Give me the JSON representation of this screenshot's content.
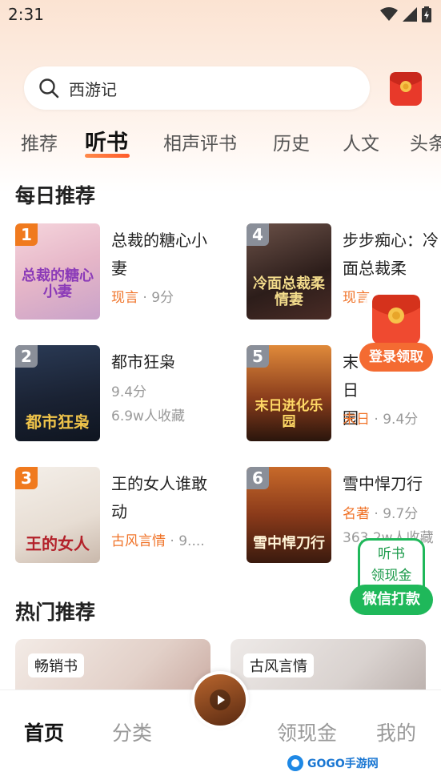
{
  "status_bar": {
    "time": "2:31"
  },
  "search": {
    "query": "西游记"
  },
  "tabs": [
    {
      "label": "推荐"
    },
    {
      "label": "听书"
    },
    {
      "label": "相声评书"
    },
    {
      "label": "历史"
    },
    {
      "label": "人文"
    },
    {
      "label": "头条"
    }
  ],
  "daily": {
    "title": "每日推荐",
    "books": [
      {
        "rank": "1",
        "title": "总裁的糖心小妻",
        "cover_text": "总裁的糖心小妻",
        "category": "现言",
        "meta": "9分"
      },
      {
        "rank": "4",
        "title": "步步痴心：冷面总裁柔",
        "cover_text": "冷面总裁柔情妻",
        "category": "现言",
        "meta": ""
      },
      {
        "rank": "2",
        "title": "都市狂枭",
        "cover_text": "都市狂枭",
        "meta_line1": "9.4分",
        "meta_line2": "6.9w人收藏"
      },
      {
        "rank": "5",
        "title": "末日园",
        "cover_text": "末日进化乐园",
        "category": "末日",
        "meta": "9.4分"
      },
      {
        "rank": "3",
        "title": "王的女人谁敢动",
        "cover_text": "王的女人",
        "category": "古风言情",
        "meta": "9...."
      },
      {
        "rank": "6",
        "title": "雪中悍刀行",
        "cover_text": "雪中悍刀行",
        "category": "名著",
        "meta": "9.7分",
        "meta_line2": "363.2w人收藏"
      }
    ]
  },
  "hot": {
    "title": "热门推荐",
    "cards": [
      {
        "tag": "畅销书"
      },
      {
        "tag": "古风言情"
      }
    ]
  },
  "floats": {
    "login_reward": "登录领取",
    "listen_line1": "听书",
    "listen_line2": "领现金",
    "wechat_pay": "微信打款"
  },
  "bottom_nav": {
    "home": "首页",
    "category": "分类",
    "cash": "领现金",
    "mine": "我的"
  },
  "watermark": "GOGO手游网",
  "colors": {
    "accent": "#f0742a",
    "green": "#1fb85a"
  }
}
